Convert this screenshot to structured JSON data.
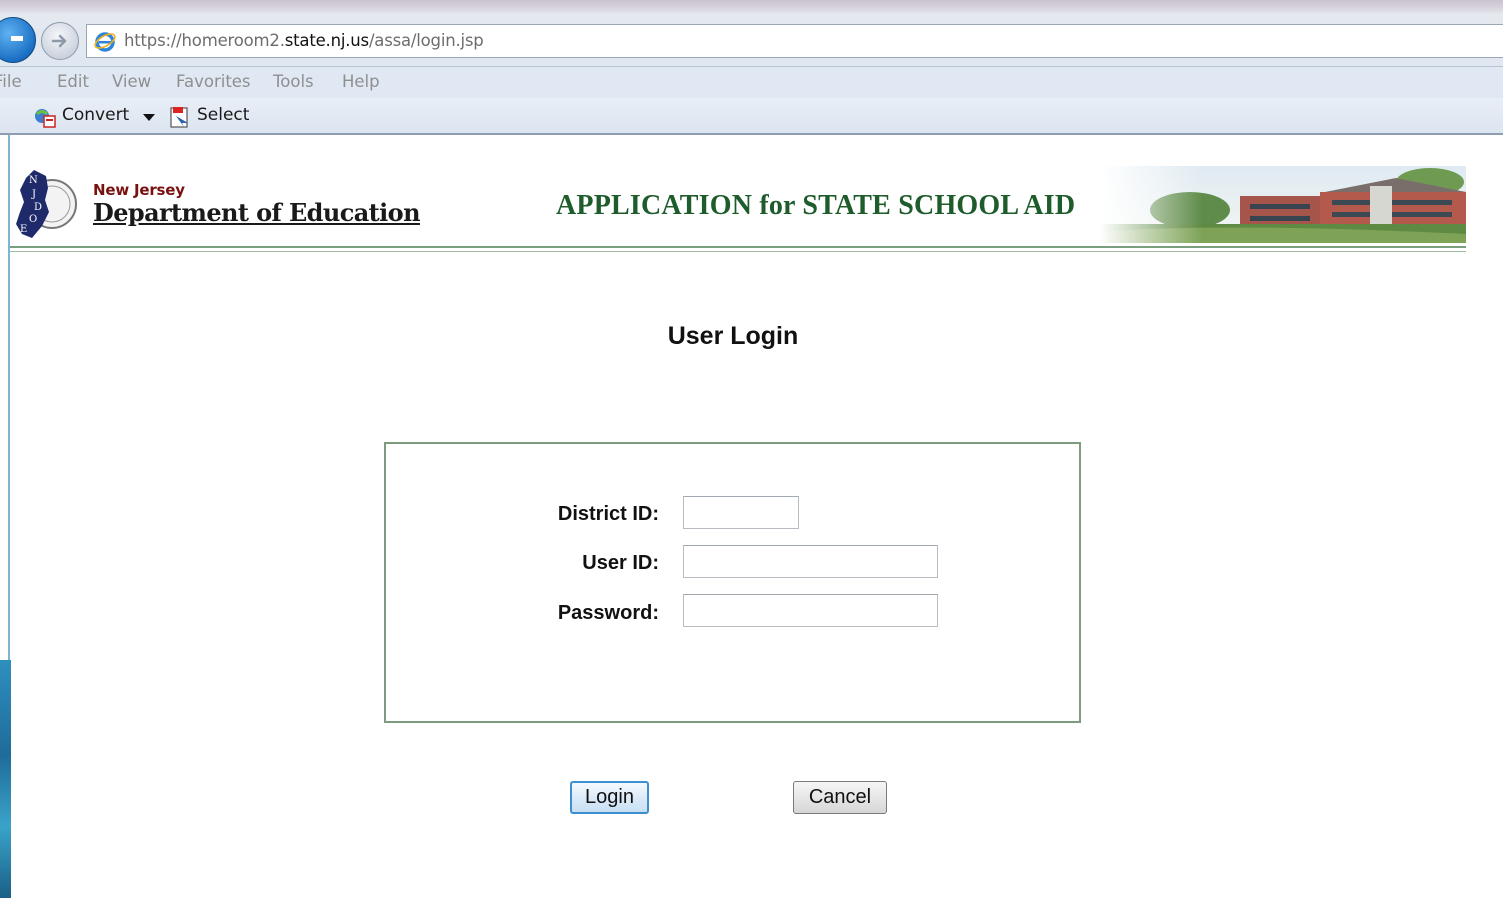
{
  "browser": {
    "url_prefix": "https://homeroom2.",
    "url_domain": "state.nj.us",
    "url_path": "/assa/login.jsp",
    "menu": [
      "File",
      "Edit",
      "View",
      "Favorites",
      "Tools",
      "Help"
    ],
    "toolbar": {
      "convert_label": "Convert",
      "select_label": "Select"
    }
  },
  "header": {
    "org_small": "New Jersey",
    "org_name": "Department of Education",
    "app_title": "APPLICATION for STATE SCHOOL AID",
    "seal_letters": [
      "N",
      "J",
      "D",
      "O",
      "E"
    ]
  },
  "page": {
    "heading": "User Login"
  },
  "form": {
    "district_label": "District ID:",
    "district_value": "",
    "user_label": "User ID:",
    "user_value": "",
    "password_label": "Password:",
    "password_value": ""
  },
  "buttons": {
    "login": "Login",
    "cancel": "Cancel"
  },
  "colors": {
    "title_green": "#1e5c2c",
    "dept_red": "#7a1111",
    "box_border": "#7e9b80"
  }
}
